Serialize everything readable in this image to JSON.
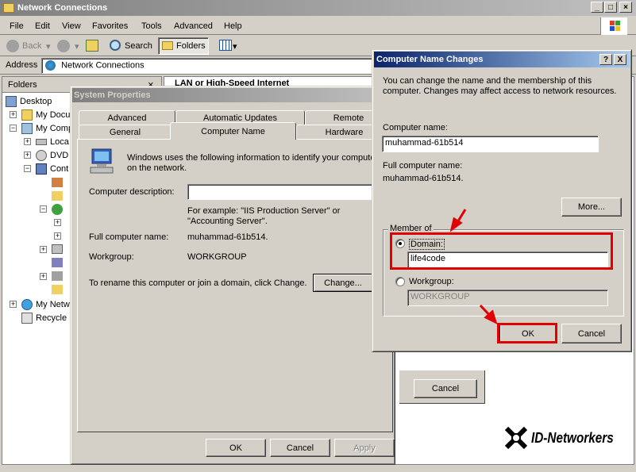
{
  "explorer": {
    "title": "Network Connections",
    "menu": [
      "File",
      "Edit",
      "View",
      "Favorites",
      "Tools",
      "Advanced",
      "Help"
    ],
    "toolbar": {
      "back": "Back",
      "search": "Search",
      "folders": "Folders"
    },
    "address_label": "Address",
    "address_value": "Network Connections",
    "folders_pane_title": "Folders",
    "tree": [
      "Desktop",
      "My Docu",
      "My Comp",
      "Loca",
      "DVD",
      "Cont",
      "My Netw",
      "Recycle"
    ],
    "content_heading": "LAN or High-Speed Internet",
    "bg_cancel": "Cancel"
  },
  "system_properties": {
    "title": "System Properties",
    "tabs_back": [
      "Advanced",
      "Automatic Updates",
      "Remote"
    ],
    "tabs_front": [
      "General",
      "Computer Name",
      "Hardware"
    ],
    "intro": "Windows uses the following information to identify your computer on the network.",
    "description_label": "Computer description:",
    "description_value": "",
    "example": "For example: \"IIS Production Server\" or \"Accounting Server\".",
    "full_name_label": "Full computer name:",
    "full_name_value": "muhammad-61b514.",
    "workgroup_label": "Workgroup:",
    "workgroup_value": "WORKGROUP",
    "rename_text": "To rename this computer or join a domain, click Change.",
    "change_button": "Change...",
    "ok": "OK",
    "cancel": "Cancel",
    "apply": "Apply"
  },
  "name_changes": {
    "title": "Computer Name Changes",
    "help_btn": "?",
    "close_btn": "X",
    "intro": "You can change the name and the membership of this computer. Changes may affect access to network resources.",
    "computer_name_label": "Computer name:",
    "computer_name_value": "muhammad-61b514",
    "full_name_label": "Full computer name:",
    "full_name_value": "muhammad-61b514.",
    "more_button": "More...",
    "member_of": "Member of",
    "domain_label": "Domain:",
    "domain_value": "life4code",
    "workgroup_label": "Workgroup:",
    "workgroup_value": "WORKGROUP",
    "ok": "OK",
    "cancel": "Cancel"
  },
  "watermark": "ID-Networkers",
  "colors": {
    "highlight_red": "#e00000",
    "active_title": "#0a246a"
  }
}
